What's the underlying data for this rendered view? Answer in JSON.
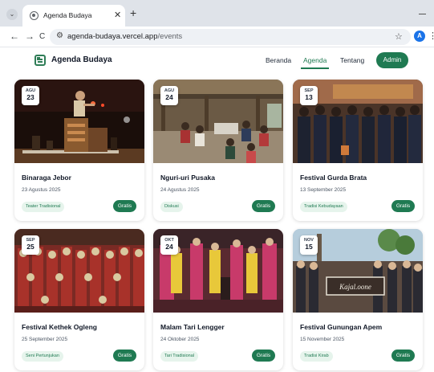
{
  "browser": {
    "tab_title": "Agenda Budaya",
    "tab_close": "✕",
    "new_tab": "+",
    "back": "←",
    "forward": "→",
    "reload": "C",
    "url_host": "agenda-budaya.vercel.app",
    "url_path": "/events",
    "profile_initial": "A",
    "menu": "⋮",
    "bookmark": "☆"
  },
  "header": {
    "brand": "Agenda Budaya",
    "nav": [
      "Beranda",
      "Agenda",
      "Tentang"
    ],
    "active_nav": "Agenda",
    "admin_label": "Admin"
  },
  "events": [
    {
      "month": "AGU",
      "day": "23",
      "title": "Binaraga Jebor",
      "date": "23 Agustus 2025",
      "category": "Teater Tradisional",
      "price": "Gratis"
    },
    {
      "month": "AGU",
      "day": "24",
      "title": "Nguri-uri Pusaka",
      "date": "24 Agustus 2025",
      "category": "Diskusi",
      "price": "Gratis"
    },
    {
      "month": "SEP",
      "day": "13",
      "title": "Festival Gurda Brata",
      "date": "13 September 2025",
      "category": "Tradisi Kebudayaan",
      "price": "Gratis"
    },
    {
      "month": "SEP",
      "day": "25",
      "title": "Festival Kethek Ogleng",
      "date": "25 September 2025",
      "category": "Seni Pertunjukan",
      "price": "Gratis"
    },
    {
      "month": "OKT",
      "day": "24",
      "title": "Malam Tari Lengger",
      "date": "24 Oktober 2025",
      "category": "Tari Tradisional",
      "price": "Gratis"
    },
    {
      "month": "NOV",
      "day": "15",
      "title": "Festival Gunungan Apem",
      "date": "15 November 2025",
      "category": "Tradisi Kirab",
      "price": "Gratis"
    }
  ],
  "photo_banner_text": "Kajal.oone",
  "colors": {
    "accent": "#1f7a52",
    "chip_bg": "#e6f4ec"
  }
}
